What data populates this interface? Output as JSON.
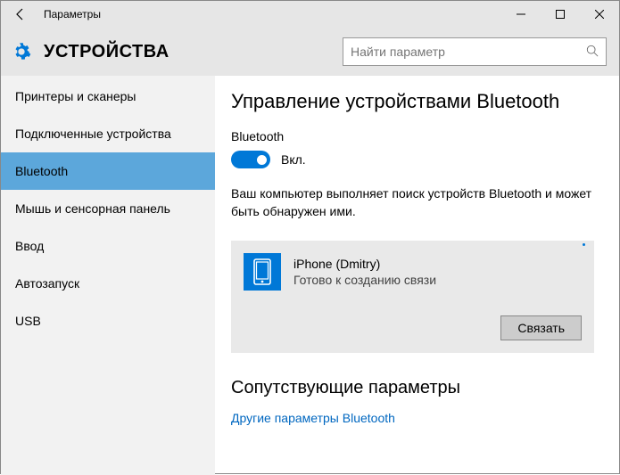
{
  "titlebar": {
    "title": "Параметры"
  },
  "header": {
    "section": "УСТРОЙСТВА",
    "search_placeholder": "Найти параметр"
  },
  "sidebar": {
    "items": [
      {
        "label": "Принтеры и сканеры"
      },
      {
        "label": "Подключенные устройства"
      },
      {
        "label": "Bluetooth"
      },
      {
        "label": "Мышь и сенсорная панель"
      },
      {
        "label": "Ввод"
      },
      {
        "label": "Автозапуск"
      },
      {
        "label": "USB"
      }
    ]
  },
  "content": {
    "heading": "Управление устройствами Bluetooth",
    "toggle_label": "Bluetooth",
    "toggle_state": "Вкл.",
    "description": "Ваш компьютер выполняет поиск устройств Bluetooth и может быть обнаружен ими.",
    "device": {
      "name": "iPhone (Dmitry)",
      "status": "Готово к созданию связи",
      "pair_label": "Связать"
    },
    "related_heading": "Сопутствующие параметры",
    "related_link": "Другие параметры Bluetooth"
  }
}
